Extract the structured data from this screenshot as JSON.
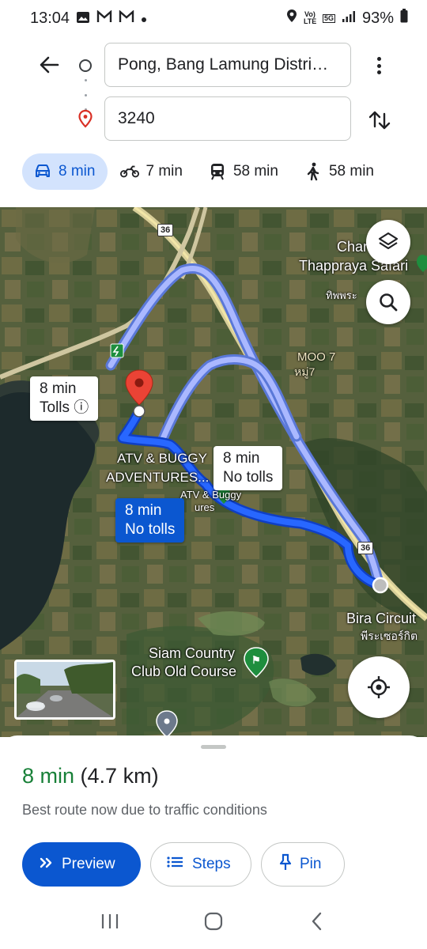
{
  "status_bar": {
    "time": "13:04",
    "battery": "93%",
    "network": "5G",
    "volte": "Vo) LTE"
  },
  "directions": {
    "origin": "Pong, Bang Lamung Distri…",
    "destination": "3240"
  },
  "travel_modes": [
    {
      "mode": "car",
      "icon": "car-icon",
      "time": "8 min",
      "active": true
    },
    {
      "mode": "motorcycle",
      "icon": "motorcycle-icon",
      "time": "7 min",
      "active": false
    },
    {
      "mode": "transit",
      "icon": "train-icon",
      "time": "58 min",
      "active": false
    },
    {
      "mode": "walk",
      "icon": "walk-icon",
      "time": "58 min",
      "active": false
    }
  ],
  "map": {
    "labels": {
      "chan_thai": "Char",
      "thapp": "Thappraya Safari",
      "thai1": "ทิพพระ",
      "moo7": "MOO 7",
      "moo7_thai": "หมู่7",
      "atv1": "ATV & BUGGY",
      "atv2": "ADVENTURES...",
      "atv_sub1": "ATV & Buggy",
      "atv_sub2": "ures",
      "bira": "Bira Circuit",
      "bira_thai": "พีระเซอร์กิต",
      "siam1": "Siam Country",
      "siam2": "Club Old Course",
      "shield1": "36",
      "shield2": "36"
    },
    "callouts": {
      "alt1_time": "8 min",
      "alt1_note": "Tolls ⓘ",
      "alt2_time": "8 min",
      "alt2_note": "No tolls",
      "best_time": "8 min",
      "best_note": "No tolls"
    }
  },
  "sheet": {
    "time": "8 min",
    "distance": "(4.7 km)",
    "subtitle": "Best route now due to traffic conditions",
    "buttons": {
      "preview": "Preview",
      "steps": "Steps",
      "pin": "Pin"
    }
  },
  "colors": {
    "accent": "#0b57d0",
    "route_primary": "#1a5cff",
    "route_alt": "#a8b8ff",
    "time_green": "#188038",
    "pin_red": "#ea4335"
  }
}
